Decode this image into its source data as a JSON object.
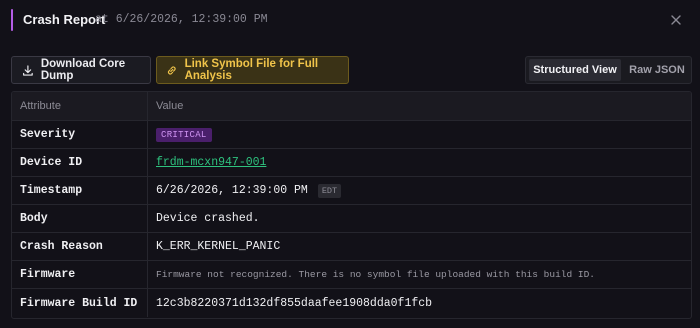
{
  "header": {
    "title": "Crash Report",
    "subtitle": "at 6/26/2026, 12:39:00 PM"
  },
  "toolbar": {
    "download_label": "Download Core Dump",
    "link_symbol_label": "Link Symbol File for Full Analysis",
    "view_toggle": {
      "options": [
        "Structured View",
        "Raw JSON"
      ],
      "selected": "Structured View"
    }
  },
  "table": {
    "columns": [
      "Attribute",
      "Value"
    ],
    "rows": {
      "severity": {
        "attr": "Severity",
        "value": "CRITICAL"
      },
      "device_id": {
        "attr": "Device ID",
        "value": "frdm-mcxn947-001"
      },
      "timestamp": {
        "attr": "Timestamp",
        "value": "6/26/2026, 12:39:00 PM",
        "tz": "EDT"
      },
      "body": {
        "attr": "Body",
        "value": "Device crashed."
      },
      "crash_reason": {
        "attr": "Crash Reason",
        "value": "K_ERR_KERNEL_PANIC"
      },
      "firmware": {
        "attr": "Firmware",
        "value": "Firmware not recognized. There is no symbol file uploaded with this build ID."
      },
      "firmware_build_id": {
        "attr": "Firmware Build ID",
        "value": "12c3b8220371d132df855daafee1908dda0f1fcb"
      }
    }
  },
  "colors": {
    "background": "#121118",
    "accent": "#b45ce6",
    "warning_button": "#f0c44a",
    "critical_badge_bg": "#4a1f6b",
    "critical_badge_text": "#cf93f2",
    "link": "#2ec27e"
  },
  "icons": {
    "close": "close-icon",
    "download": "download-icon",
    "link": "link-icon"
  }
}
